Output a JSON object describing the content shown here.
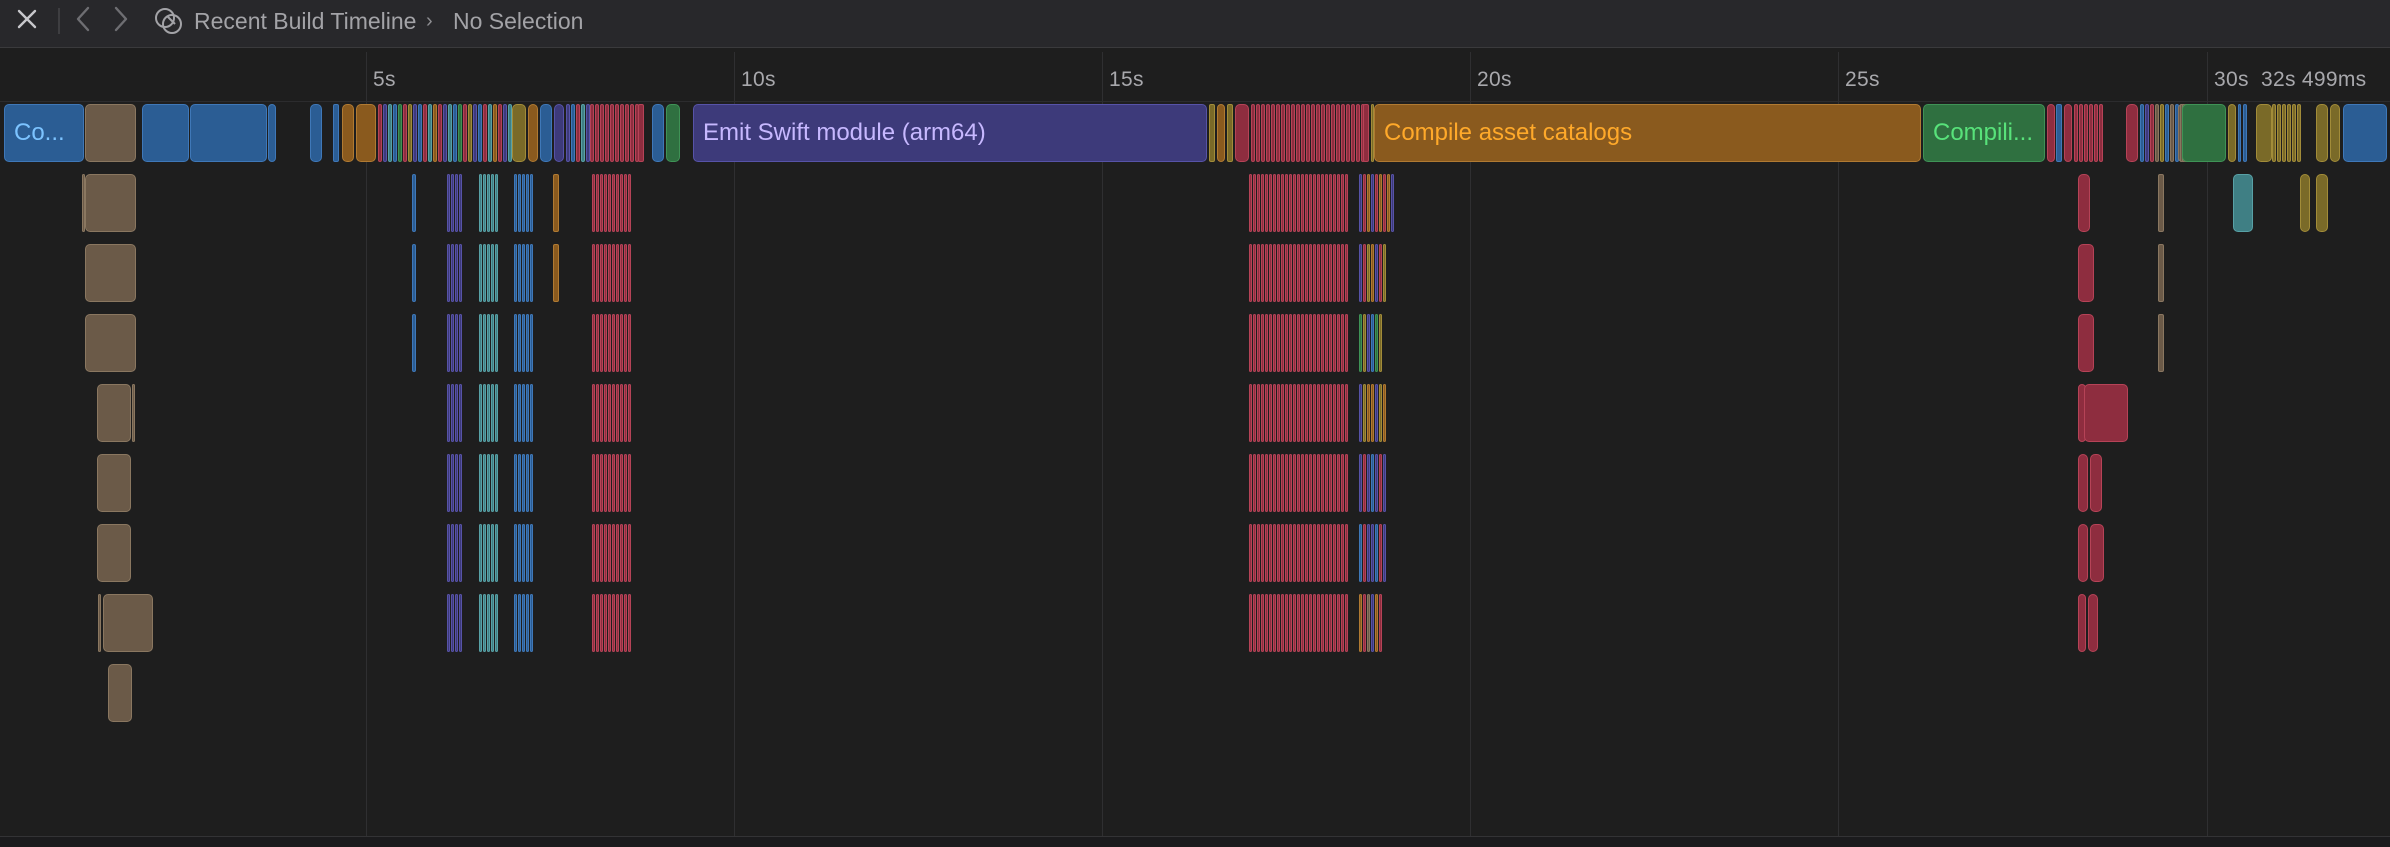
{
  "toolbar": {
    "close_icon": "close-icon",
    "back_icon": "chevron-left-icon",
    "forward_icon": "chevron-right-icon",
    "breadcrumb_icon": "build-timeline-icon",
    "breadcrumb_title": "Recent Build Timeline",
    "breadcrumb_separator": "›",
    "selection_label": "No Selection"
  },
  "timeline": {
    "ticks": [
      "5s",
      "10s",
      "15s",
      "20s",
      "25s",
      "30s"
    ],
    "end_label": "32s 499ms",
    "named_tasks": {
      "first": "Co...",
      "emit": "Emit Swift module (arm64)",
      "assets": "Compile asset catalogs",
      "compile": "Compili..."
    }
  },
  "colors": {
    "blue": "#2b5d94",
    "tan": "#6b5a48",
    "purple": "#3d3a7a",
    "teal": "#3f7f84",
    "red": "#8e2d3f",
    "orange": "#8a5a1e",
    "green": "#2f7040",
    "olive": "#7a6a28"
  }
}
